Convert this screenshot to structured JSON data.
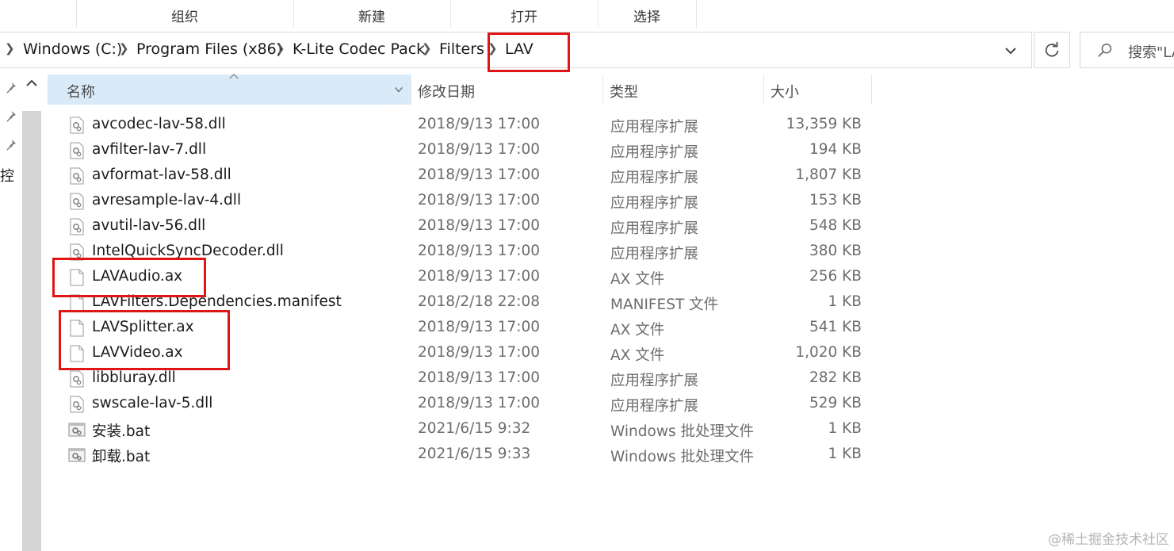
{
  "ribbon": {
    "groups": [
      {
        "label": "组织"
      },
      {
        "label": "新建"
      },
      {
        "label": "打开"
      },
      {
        "label": "选择"
      }
    ]
  },
  "address_bar": {
    "crumbs": [
      {
        "label": "Windows (C:)"
      },
      {
        "label": "Program Files (x86)"
      },
      {
        "label": "K-Lite Codec Pack"
      },
      {
        "label": "Filters"
      },
      {
        "label": "LAV"
      }
    ],
    "search_placeholder": "搜索\"LA"
  },
  "nav": {
    "partial_label": "控"
  },
  "columns": {
    "name": "名称",
    "date": "修改日期",
    "type": "类型",
    "size": "大小"
  },
  "files": [
    {
      "name": "avcodec-lav-58.dll",
      "date": "2018/9/13 17:00",
      "type": "应用程序扩展",
      "size": "13,359 KB",
      "icon": "dll-icon"
    },
    {
      "name": "avfilter-lav-7.dll",
      "date": "2018/9/13 17:00",
      "type": "应用程序扩展",
      "size": "194 KB",
      "icon": "dll-icon"
    },
    {
      "name": "avformat-lav-58.dll",
      "date": "2018/9/13 17:00",
      "type": "应用程序扩展",
      "size": "1,807 KB",
      "icon": "dll-icon"
    },
    {
      "name": "avresample-lav-4.dll",
      "date": "2018/9/13 17:00",
      "type": "应用程序扩展",
      "size": "153 KB",
      "icon": "dll-icon"
    },
    {
      "name": "avutil-lav-56.dll",
      "date": "2018/9/13 17:00",
      "type": "应用程序扩展",
      "size": "548 KB",
      "icon": "dll-icon"
    },
    {
      "name": "IntelQuickSyncDecoder.dll",
      "date": "2018/9/13 17:00",
      "type": "应用程序扩展",
      "size": "380 KB",
      "icon": "dll-icon"
    },
    {
      "name": "LAVAudio.ax",
      "date": "2018/9/13 17:00",
      "type": "AX 文件",
      "size": "256 KB",
      "icon": "file-icon"
    },
    {
      "name": "LAVFilters.Dependencies.manifest",
      "date": "2018/2/18 22:08",
      "type": "MANIFEST 文件",
      "size": "1 KB",
      "icon": "file-icon"
    },
    {
      "name": "LAVSplitter.ax",
      "date": "2018/9/13 17:00",
      "type": "AX 文件",
      "size": "541 KB",
      "icon": "file-icon"
    },
    {
      "name": "LAVVideo.ax",
      "date": "2018/9/13 17:00",
      "type": "AX 文件",
      "size": "1,020 KB",
      "icon": "file-icon"
    },
    {
      "name": "libbluray.dll",
      "date": "2018/9/13 17:00",
      "type": "应用程序扩展",
      "size": "282 KB",
      "icon": "dll-icon"
    },
    {
      "name": "swscale-lav-5.dll",
      "date": "2018/9/13 17:00",
      "type": "应用程序扩展",
      "size": "529 KB",
      "icon": "dll-icon"
    },
    {
      "name": "安装.bat",
      "date": "2021/6/15 9:32",
      "type": "Windows 批处理文件",
      "size": "1 KB",
      "icon": "bat-icon"
    },
    {
      "name": "卸载.bat",
      "date": "2021/6/15 9:33",
      "type": "Windows 批处理文件",
      "size": "1 KB",
      "icon": "bat-icon"
    }
  ],
  "watermark": "@稀土掘金技术社区",
  "colors": {
    "highlight": "#e01515",
    "header_selected": "#d9ebf9"
  }
}
